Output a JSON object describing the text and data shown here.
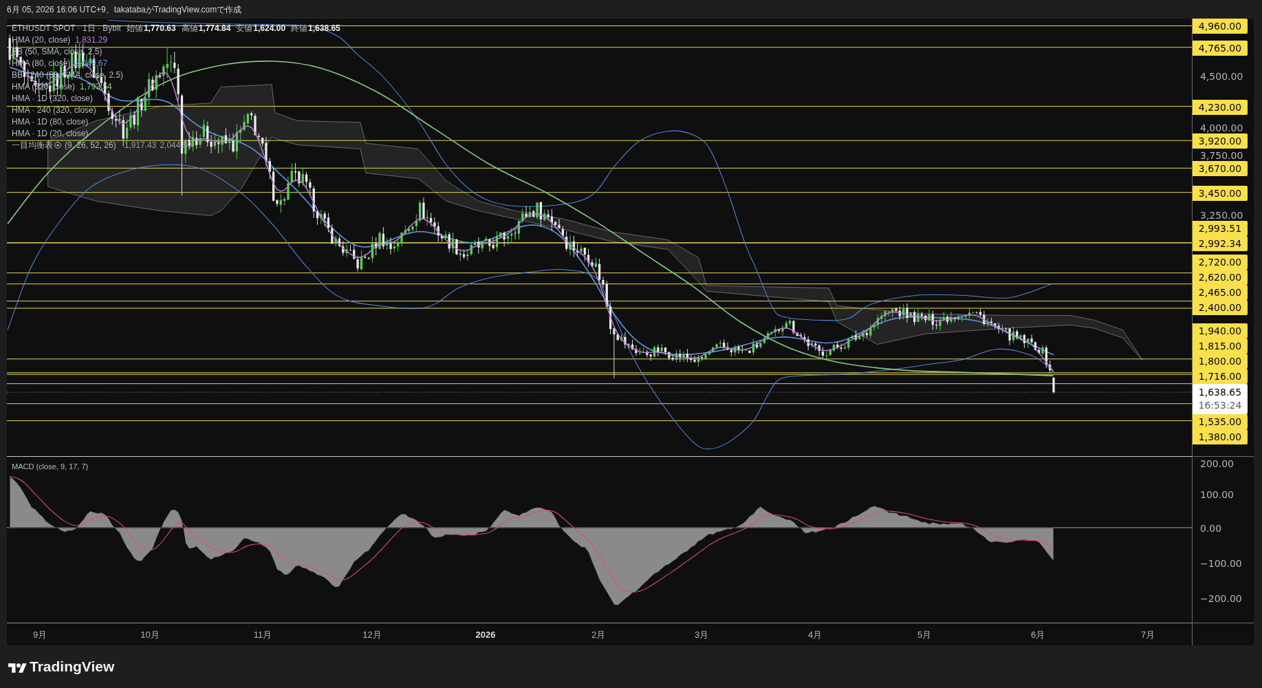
{
  "header": {
    "caption": "6月 05, 2026 16:06 UTC+9、takatabaがTradingView.comで作成"
  },
  "legend": {
    "symbol": "ETHUSDT SPOT · 1日 · Bybit",
    "ohlc": [
      {
        "label": "始値",
        "value": "1,770.63"
      },
      {
        "label": "高値",
        "value": "1,774.84"
      },
      {
        "label": "安値",
        "value": "1,624.00"
      },
      {
        "label": "終値",
        "value": "1,638.65"
      }
    ],
    "indicators": [
      {
        "kind": "hma",
        "name": "HMA (20, close)",
        "values": [
          "1,831.29"
        ],
        "color": "#b47ecf"
      },
      {
        "kind": "bb",
        "name": "BB (50, SMA, close, 2.5)"
      },
      {
        "kind": "hma",
        "name": "HMA (80, close)",
        "values": [
          "2,049.67"
        ],
        "color": "#5b95dc"
      },
      {
        "kind": "bb",
        "name": "BB · 240 (50, SMA, close, 2.5)"
      },
      {
        "kind": "hma",
        "name": "HMA (320, close)",
        "values": [
          "1,793.54"
        ],
        "color": "#86c97e"
      },
      {
        "kind": "hma",
        "name": "HMA · 1D (320, close)"
      },
      {
        "kind": "hma",
        "name": "HMA · 240 (320, close)"
      },
      {
        "kind": "hma",
        "name": "HMA · 1D (80, close)"
      },
      {
        "kind": "hma",
        "name": "HMA · 1D (20, close)"
      },
      {
        "kind": "ichimoku",
        "name": "一目均衡表",
        "params": "(9, 26, 52, 26)",
        "values": [
          "1,917.43",
          "2,044.50"
        ]
      }
    ]
  },
  "price_axis": [
    {
      "kind": "level",
      "text": "4,960.00"
    },
    {
      "kind": "level",
      "text": "4,765.00"
    },
    {
      "kind": "tick",
      "text": "4,500.00"
    },
    {
      "kind": "level",
      "text": "4,230.00"
    },
    {
      "kind": "tick",
      "text": "4,000.00"
    },
    {
      "kind": "level",
      "text": "3,920.00"
    },
    {
      "kind": "tick",
      "text": "3,750.00"
    },
    {
      "kind": "level",
      "text": "3,670.00"
    },
    {
      "kind": "level",
      "text": "3,450.00"
    },
    {
      "kind": "tick",
      "text": "3,250.00"
    },
    {
      "kind": "level",
      "text": "2,993.51"
    },
    {
      "kind": "level",
      "text": "2,992.34"
    },
    {
      "kind": "level",
      "text": "2,720.00"
    },
    {
      "kind": "level",
      "text": "2,620.00"
    },
    {
      "kind": "level",
      "text": "2,465.00"
    },
    {
      "kind": "level",
      "text": "2,400.00"
    },
    {
      "kind": "level",
      "text": "1,940.00"
    },
    {
      "kind": "level",
      "text": "1,815.00"
    },
    {
      "kind": "level",
      "text": "1,800.00"
    },
    {
      "kind": "level",
      "text": "1,716.00"
    },
    {
      "kind": "last",
      "text": "1,638.65",
      "countdown": "16:53:24"
    },
    {
      "kind": "level",
      "text": "1,535.00"
    },
    {
      "kind": "level",
      "text": "1,380.00"
    }
  ],
  "macd": {
    "title": "MACD (close, 9, 17, 7)",
    "axis": [
      "200.00",
      "100.00",
      "0.00",
      "−100.00",
      "−200.00"
    ]
  },
  "time_axis": [
    {
      "kind": "month",
      "label": "9月"
    },
    {
      "kind": "month",
      "label": "10月"
    },
    {
      "kind": "month",
      "label": "11月"
    },
    {
      "kind": "month",
      "label": "12月"
    },
    {
      "kind": "year",
      "label": "2026"
    },
    {
      "kind": "month",
      "label": "2月"
    },
    {
      "kind": "month",
      "label": "3月"
    },
    {
      "kind": "month",
      "label": "4月"
    },
    {
      "kind": "month",
      "label": "5月"
    },
    {
      "kind": "month",
      "label": "6月"
    },
    {
      "kind": "month",
      "label": "7月"
    }
  ],
  "footer": {
    "brand": "TradingView"
  }
}
